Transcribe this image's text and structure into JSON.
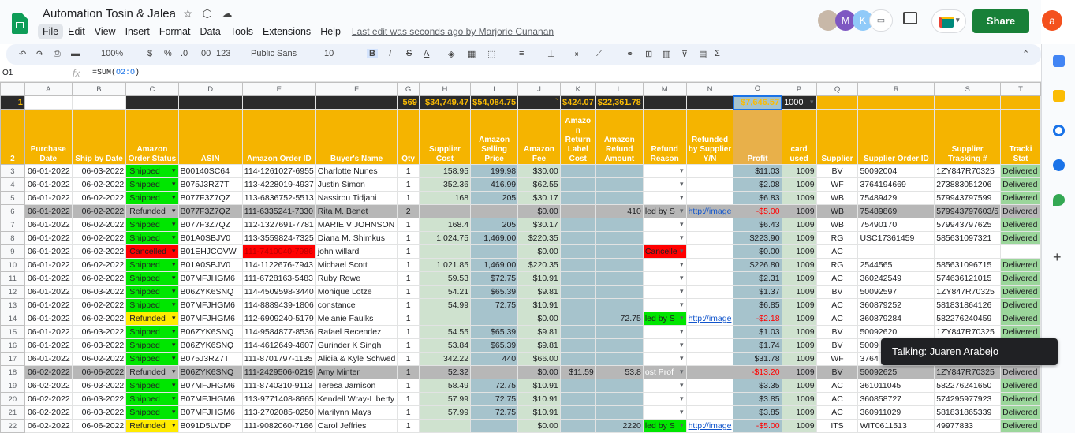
{
  "document": {
    "title": "Automation Tosin & Jalea",
    "last_edit": "Last edit was seconds ago by Marjorie Cunanan"
  },
  "menu": [
    "File",
    "Edit",
    "View",
    "Insert",
    "Format",
    "Data",
    "Tools",
    "Extensions",
    "Help"
  ],
  "share_label": "Share",
  "account_initial": "a",
  "collaborators": [
    "M",
    "K"
  ],
  "toolbar": {
    "zoom": "100%",
    "currency": "$",
    "percent": "%",
    "dec_less": ".0",
    "dec_more": ".00",
    "num_fmt": "123",
    "font": "Public Sans",
    "size": "10",
    "bold": "B",
    "italic": "I",
    "strike": "S",
    "text_color": "A"
  },
  "formula_bar": {
    "cell": "O1",
    "fx": "fx",
    "formula_prefix": "=SUM(",
    "formula_ref": "O2:O",
    "formula_suffix": ")"
  },
  "columns": [
    "A",
    "B",
    "C",
    "D",
    "E",
    "F",
    "G",
    "H",
    "I",
    "J",
    "K",
    "L",
    "M",
    "N",
    "O",
    "P",
    "Q",
    "R",
    "S",
    "T"
  ],
  "row1": {
    "G": "569",
    "H": "$34,749.47",
    "I": "$54,084.75",
    "J": "`",
    "K": "$424.07",
    "L": "$22,361.78",
    "O": "$7,646.57",
    "P": "1000"
  },
  "headers": [
    "Purchase Date",
    "Ship by Date",
    "Amazon Order Status",
    "ASIN",
    "Amazon Order ID",
    "Buyer's Name",
    "Qty",
    "Supplier Cost",
    "Amazon Selling Price",
    "Amazon Fee",
    "Amazo n Return Label Cost",
    "Amazon Refund Amount",
    "Refund Reason",
    "Refunded by Supplier Y/N",
    "Profit",
    "card used",
    "Supplier",
    "Supplier Order ID",
    "Supplier Tracking #",
    "Tracki Stat"
  ],
  "rows": [
    {
      "n": "3",
      "a": "06-01-2022",
      "b": "06-03-2022",
      "st": "Shipped",
      "asin": "B00140SC64",
      "oid": "114-1261027-6955",
      "buyer": "Charlotte Nunes",
      "qty": "1",
      "cost": "158.95",
      "price": "199.98",
      "fee": "$30.00",
      "rlc": "",
      "ref": "",
      "reason": "",
      "rby": "",
      "profit": "$11.03",
      "card": "1009",
      "sup": "BV",
      "soid": "50092004",
      "trk": "1ZY847R70325",
      "ts": "Delivered"
    },
    {
      "n": "4",
      "a": "06-01-2022",
      "b": "06-02-2022",
      "st": "Shipped",
      "asin": "B075J3RZ7T",
      "oid": "113-4228019-4937",
      "buyer": "Justin Simon",
      "qty": "1",
      "cost": "352.36",
      "price": "416.99",
      "fee": "$62.55",
      "rlc": "",
      "ref": "",
      "reason": "",
      "rby": "",
      "profit": "$2.08",
      "card": "1009",
      "sup": "WF",
      "soid": "3764194669",
      "trk": "273883051206",
      "ts": "Delivered"
    },
    {
      "n": "5",
      "a": "06-01-2022",
      "b": "06-02-2022",
      "st": "Shipped",
      "asin": "B077F3Z7QZ",
      "oid": "113-6836752-5513",
      "buyer": "Nassirou Tidjani",
      "qty": "1",
      "cost": "168",
      "price": "205",
      "fee": "$30.17",
      "rlc": "",
      "ref": "",
      "reason": "",
      "rby": "",
      "profit": "$6.83",
      "card": "1009",
      "sup": "WB",
      "soid": "75489429",
      "trk": "579943797599",
      "ts": "Delivered"
    },
    {
      "n": "6",
      "a": "06-01-2022",
      "b": "06-02-2022",
      "st": "Refunded",
      "asin": "B077F3Z7QZ",
      "oid": "111-6335241-7330",
      "buyer": "Rita M. Benet",
      "qty": "2",
      "cost": "",
      "price": "",
      "fee": "$0.00",
      "rlc": "",
      "ref": "410",
      "reason": "led by S",
      "rby": "http://image",
      "profit": "-$5.00",
      "card": "1009",
      "sup": "WB",
      "soid": "75489869",
      "trk": "579943797603/5",
      "ts": "Delivered",
      "gray": true
    },
    {
      "n": "7",
      "a": "06-01-2022",
      "b": "06-02-2022",
      "st": "Shipped",
      "asin": "B077F3Z7QZ",
      "oid": "112-1327691-7781",
      "buyer": "MARIE V JOHNSON",
      "qty": "1",
      "cost": "168.4",
      "price": "205",
      "fee": "$30.17",
      "rlc": "",
      "ref": "",
      "reason": "",
      "rby": "",
      "profit": "$6.43",
      "card": "1009",
      "sup": "WB",
      "soid": "75490170",
      "trk": "579943797625",
      "ts": "Delivered"
    },
    {
      "n": "8",
      "a": "06-01-2022",
      "b": "06-02-2022",
      "st": "Shipped",
      "asin": "B01A0SBJV0",
      "oid": "113-3559824-7325",
      "buyer": "Diana M. Shimkus",
      "qty": "1",
      "cost": "1,024.75",
      "price": "1,469.00",
      "fee": "$220.35",
      "rlc": "",
      "ref": "",
      "reason": "",
      "rby": "",
      "profit": "$223.90",
      "card": "1009",
      "sup": "RG",
      "soid": "USC17361459",
      "trk": "585631097321",
      "ts": "Delivered"
    },
    {
      "n": "9",
      "a": "06-01-2022",
      "b": "06-02-2022",
      "st": "Cancelled",
      "asin": "B01EHJCOVW",
      "oid": "111-7410040-7986",
      "buyer": "john willard",
      "qty": "1",
      "cost": "",
      "price": "",
      "fee": "$0.00",
      "rlc": "",
      "ref": "",
      "reason": "Cancelle",
      "rby": "",
      "profit": "$0.00",
      "card": "1009",
      "sup": "AC",
      "soid": "",
      "trk": "",
      "ts": ""
    },
    {
      "n": "10",
      "a": "06-01-2022",
      "b": "06-02-2022",
      "st": "Shipped",
      "asin": "B01A0SBJV0",
      "oid": "114-1122676-7943",
      "buyer": "Michael Scott",
      "qty": "1",
      "cost": "1,021.85",
      "price": "1,469.00",
      "fee": "$220.35",
      "rlc": "",
      "ref": "",
      "reason": "",
      "rby": "",
      "profit": "$226.80",
      "card": "1009",
      "sup": "RG",
      "soid": "2544565",
      "trk": "585631096715",
      "ts": "Delivered"
    },
    {
      "n": "11",
      "a": "06-01-2022",
      "b": "06-02-2022",
      "st": "Shipped",
      "asin": "B07MFJHGM6",
      "oid": "111-6728163-5483",
      "buyer": "Ruby Rowe",
      "qty": "1",
      "cost": "59.53",
      "price": "$72.75",
      "fee": "$10.91",
      "rlc": "",
      "ref": "",
      "reason": "",
      "rby": "",
      "profit": "$2.31",
      "card": "1009",
      "sup": "AC",
      "soid": "360242549",
      "trk": "574636121015",
      "ts": "Delivered"
    },
    {
      "n": "12",
      "a": "06-01-2022",
      "b": "06-03-2022",
      "st": "Shipped",
      "asin": "B06ZYK6SNQ",
      "oid": "114-4509598-3440",
      "buyer": "Monique Lotze",
      "qty": "1",
      "cost": "54.21",
      "price": "$65.39",
      "fee": "$9.81",
      "rlc": "",
      "ref": "",
      "reason": "",
      "rby": "",
      "profit": "$1.37",
      "card": "1009",
      "sup": "BV",
      "soid": "50092597",
      "trk": "1ZY847R70325",
      "ts": "Delivered"
    },
    {
      "n": "13",
      "a": "06-01-2022",
      "b": "06-02-2022",
      "st": "Shipped",
      "asin": "B07MFJHGM6",
      "oid": "114-8889439-1806",
      "buyer": "constance",
      "qty": "1",
      "cost": "54.99",
      "price": "72.75",
      "fee": "$10.91",
      "rlc": "",
      "ref": "",
      "reason": "",
      "rby": "",
      "profit": "$6.85",
      "card": "1009",
      "sup": "AC",
      "soid": "360879252",
      "trk": "581831864126",
      "ts": "Delivered"
    },
    {
      "n": "14",
      "a": "06-01-2022",
      "b": "06-02-2022",
      "st": "Refunded",
      "asin": "B07MFJHGM6",
      "oid": "112-6909240-5179",
      "buyer": "Melanie Faulks",
      "qty": "1",
      "cost": "",
      "price": "",
      "fee": "$0.00",
      "rlc": "",
      "ref": "72.75",
      "reason": "led by S",
      "rby": "http://image",
      "profit": "-$2.18",
      "card": "1009",
      "sup": "AC",
      "soid": "360879284",
      "trk": "582276240459",
      "ts": "Delivered"
    },
    {
      "n": "15",
      "a": "06-01-2022",
      "b": "06-03-2022",
      "st": "Shipped",
      "asin": "B06ZYK6SNQ",
      "oid": "114-9584877-8536",
      "buyer": "Rafael Recendez",
      "qty": "1",
      "cost": "54.55",
      "price": "$65.39",
      "fee": "$9.81",
      "rlc": "",
      "ref": "",
      "reason": "",
      "rby": "",
      "profit": "$1.03",
      "card": "1009",
      "sup": "BV",
      "soid": "50092620",
      "trk": "1ZY847R70325",
      "ts": "Delivered"
    },
    {
      "n": "16",
      "a": "06-01-2022",
      "b": "06-03-2022",
      "st": "Shipped",
      "asin": "B06ZYK6SNQ",
      "oid": "114-4612649-4607",
      "buyer": "Gurinder K Singh",
      "qty": "1",
      "cost": "53.84",
      "price": "$65.39",
      "fee": "$9.81",
      "rlc": "",
      "ref": "",
      "reason": "",
      "rby": "",
      "profit": "$1.74",
      "card": "1009",
      "sup": "BV",
      "soid": "5009",
      "trk": "",
      "ts": "Delivered"
    },
    {
      "n": "17",
      "a": "06-01-2022",
      "b": "06-02-2022",
      "st": "Shipped",
      "asin": "B075J3RZ7T",
      "oid": "111-8701797-1135",
      "buyer": "Alicia & Kyle Schwed",
      "qty": "1",
      "cost": "342.22",
      "price": "440",
      "fee": "$66.00",
      "rlc": "",
      "ref": "",
      "reason": "",
      "rby": "",
      "profit": "$31.78",
      "card": "1009",
      "sup": "WF",
      "soid": "3764",
      "trk": "",
      "ts": "Delivered"
    },
    {
      "n": "18",
      "a": "06-02-2022",
      "b": "06-06-2022",
      "st": "Refunded",
      "asin": "B06ZYK6SNQ",
      "oid": "111-2429506-0219",
      "buyer": "Amy Minter",
      "qty": "1",
      "cost": "52.32",
      "price": "",
      "fee": "$0.00",
      "rlc": "$11.59",
      "ref": "53.8",
      "reason": "ost Prof",
      "rby": "",
      "profit": "-$13.20",
      "card": "1009",
      "sup": "BV",
      "soid": "50092625",
      "trk": "1ZY847R70325",
      "ts": "Delivered",
      "gray": true
    },
    {
      "n": "19",
      "a": "06-02-2022",
      "b": "06-03-2022",
      "st": "Shipped",
      "asin": "B07MFJHGM6",
      "oid": "111-8740310-9113",
      "buyer": "Teresa Jamison",
      "qty": "1",
      "cost": "58.49",
      "price": "72.75",
      "fee": "$10.91",
      "rlc": "",
      "ref": "",
      "reason": "",
      "rby": "",
      "profit": "$3.35",
      "card": "1009",
      "sup": "AC",
      "soid": "361011045",
      "trk": "582276241650",
      "ts": "Delivered"
    },
    {
      "n": "20",
      "a": "06-02-2022",
      "b": "06-03-2022",
      "st": "Shipped",
      "asin": "B07MFJHGM6",
      "oid": "113-9771408-8665",
      "buyer": "Kendell Wray-Liberty",
      "qty": "1",
      "cost": "57.99",
      "price": "72.75",
      "fee": "$10.91",
      "rlc": "",
      "ref": "",
      "reason": "",
      "rby": "",
      "profit": "$3.85",
      "card": "1009",
      "sup": "AC",
      "soid": "360858727",
      "trk": "574295977923",
      "ts": "Delivered"
    },
    {
      "n": "21",
      "a": "06-02-2022",
      "b": "06-03-2022",
      "st": "Shipped",
      "asin": "B07MFJHGM6",
      "oid": "113-2702085-0250",
      "buyer": "Marilynn Mays",
      "qty": "1",
      "cost": "57.99",
      "price": "72.75",
      "fee": "$10.91",
      "rlc": "",
      "ref": "",
      "reason": "",
      "rby": "",
      "profit": "$3.85",
      "card": "1009",
      "sup": "AC",
      "soid": "360911029",
      "trk": "581831865339",
      "ts": "Delivered"
    },
    {
      "n": "22",
      "a": "06-02-2022",
      "b": "06-06-2022",
      "st": "Refunded",
      "asin": "B091D5LVDP",
      "oid": "111-9082060-7166",
      "buyer": "Carol Jeffries",
      "qty": "1",
      "cost": "",
      "price": "",
      "fee": "$0.00",
      "rlc": "",
      "ref": "2220",
      "reason": "led by S",
      "rby": "http://image",
      "profit": "-$5.00",
      "card": "1009",
      "sup": "ITS",
      "soid": "WIT0611513",
      "trk": "49977833",
      "ts": "Delivered"
    }
  ],
  "tooltip": "Talking: Juaren Arabejo",
  "colors": {
    "shipped": "#00e600",
    "refunded": "#ffeb00",
    "cancelled": "#ff0000",
    "header": "#f5b400",
    "share": "#188038"
  }
}
